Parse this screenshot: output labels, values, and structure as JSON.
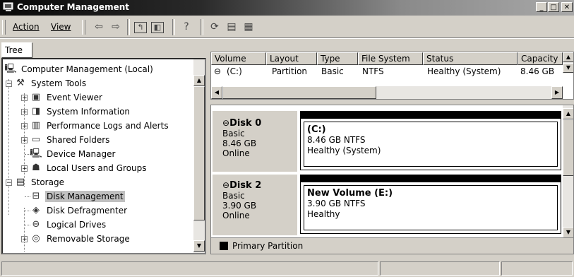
{
  "window": {
    "title": "Computer Management",
    "buttons": {
      "minimize": "_",
      "maximize": "□",
      "close": "✕"
    }
  },
  "toolbar": {
    "action_label": "Action",
    "view_label": "View"
  },
  "tree": {
    "tab_label": "Tree",
    "items": [
      {
        "label": "Computer Management (Local)",
        "icon": "computer-icon"
      },
      {
        "label": "System Tools",
        "icon": "tools-icon"
      },
      {
        "label": "Event Viewer",
        "icon": "event-viewer-icon"
      },
      {
        "label": "System Information",
        "icon": "system-info-icon"
      },
      {
        "label": "Performance Logs and Alerts",
        "icon": "performance-icon"
      },
      {
        "label": "Shared Folders",
        "icon": "shared-folder-icon"
      },
      {
        "label": "Device Manager",
        "icon": "device-manager-icon"
      },
      {
        "label": "Local Users and Groups",
        "icon": "users-icon"
      },
      {
        "label": "Storage",
        "icon": "storage-icon"
      },
      {
        "label": "Disk Management",
        "icon": "disk-management-icon",
        "selected": true
      },
      {
        "label": "Disk Defragmenter",
        "icon": "defrag-icon"
      },
      {
        "label": "Logical Drives",
        "icon": "logical-drive-icon"
      },
      {
        "label": "Removable Storage",
        "icon": "removable-storage-icon"
      }
    ]
  },
  "volume_list": {
    "columns": [
      "Volume",
      "Layout",
      "Type",
      "File System",
      "Status",
      "Capacity"
    ],
    "rows": [
      {
        "volume": "(C:)",
        "layout": "Partition",
        "type": "Basic",
        "file_system": "NTFS",
        "status": "Healthy (System)",
        "capacity": "8.46 GB"
      }
    ]
  },
  "disks": [
    {
      "name": "Disk 0",
      "type": "Basic",
      "size": "8.46 GB",
      "state": "Online",
      "volume": {
        "name": "(C:)",
        "detail": "8.46 GB NTFS",
        "status": "Healthy (System)"
      }
    },
    {
      "name": "Disk 2",
      "type": "Basic",
      "size": "3.90 GB",
      "state": "Online",
      "volume": {
        "name": "New Volume  (E:)",
        "detail": "3.90 GB NTFS",
        "status": "Healthy"
      }
    }
  ],
  "legend": {
    "label": "Primary Partition",
    "color": "#000000"
  }
}
